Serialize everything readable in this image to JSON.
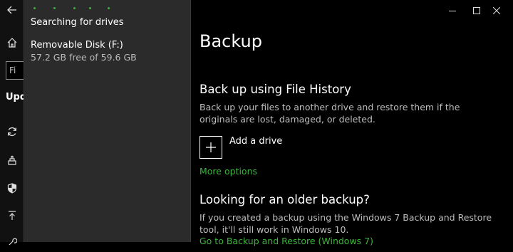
{
  "nav": {
    "search_placeholder": "Fi",
    "section_label": "Upd",
    "items": [
      {
        "icon": "back-arrow-icon"
      },
      {
        "icon": "home-icon"
      },
      {
        "icon": "sync-icon"
      },
      {
        "icon": "delivery-icon"
      },
      {
        "icon": "shield-icon"
      },
      {
        "icon": "upload-icon"
      }
    ]
  },
  "flyout": {
    "status": "Searching for drives",
    "drives": [
      {
        "name": "Removable Disk (F:)",
        "free": "57.2 GB free of 59.6 GB"
      }
    ]
  },
  "window": {
    "buttons": [
      "minimize",
      "maximize",
      "close"
    ]
  },
  "main": {
    "title": "Backup",
    "file_history": {
      "heading": "Back up using File History",
      "description": "Back up your files to another drive and restore them if the originals are lost, damaged, or deleted.",
      "add_drive_label": "Add a drive",
      "more_options": "More options"
    },
    "older_backup": {
      "heading": "Looking for an older backup?",
      "description": "If you created a backup using the Windows 7 Backup and Restore tool, it'll still work in Windows 10.",
      "link": "Go to Backup and Restore (Windows 7)"
    }
  },
  "colors": {
    "accent": "#3cb43c",
    "background": "#000000",
    "flyout": "#2b2b2b"
  }
}
